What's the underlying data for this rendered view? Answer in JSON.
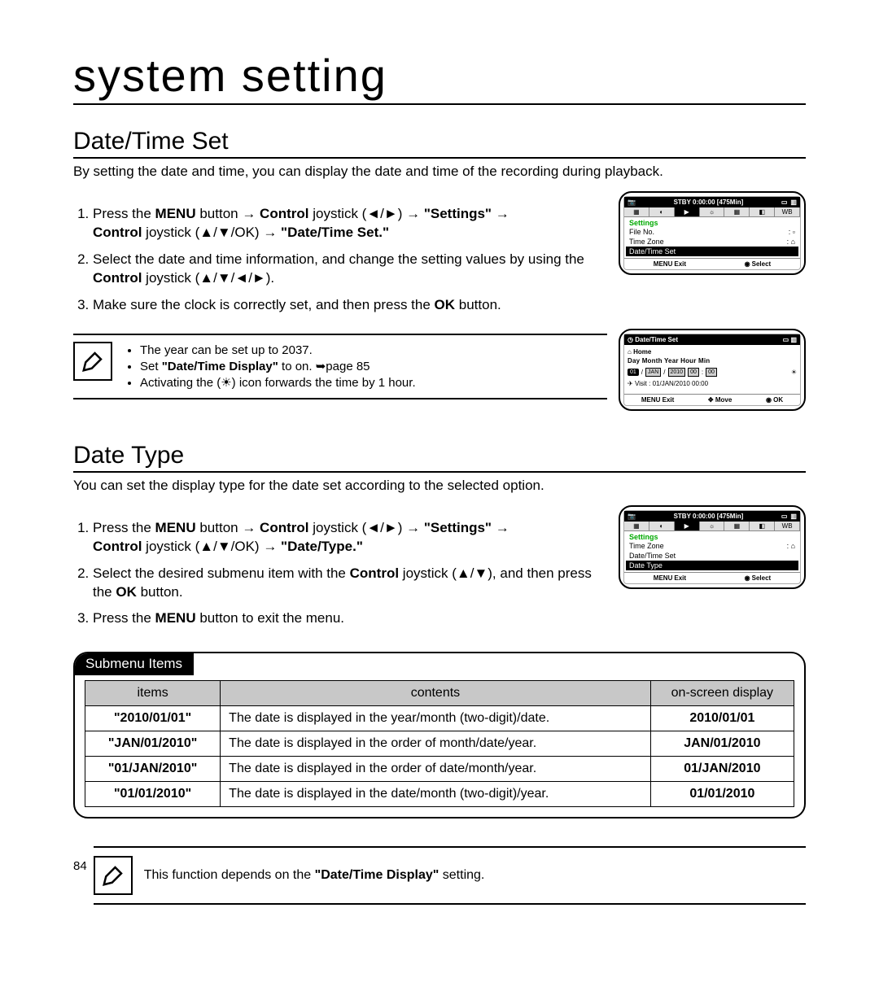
{
  "page_number": "84",
  "chapter_title": "system setting",
  "datetime": {
    "title": "Date/Time Set",
    "intro": "By setting the date and time, you can display the date and time of the recording during playback.",
    "step1_a": "Press the ",
    "step1_menu": "MENU",
    "step1_b": " button → ",
    "step1_control": "Control",
    "step1_c": " joystick (◄/►) → ",
    "step1_settings": "\"Settings\"",
    "step1_d": " → ",
    "step1_line2a": "Control",
    "step1_line2b": " joystick (▲/▼/OK) → ",
    "step1_line2c": "\"Date/Time Set.\"",
    "step2_a": "Select the date and time information, and change the setting values by using the ",
    "step2_b": "Control",
    "step2_c": " joystick (▲/▼/◄/►).",
    "step3_a": "Make sure the clock is correctly set, and then press the ",
    "step3_b": "OK",
    "step3_c": " button.",
    "note1": "The year can be set up to 2037.",
    "note2_a": "Set ",
    "note2_b": "\"Date/Time Display\"",
    "note2_c": " to on. ➥page 85",
    "note3_a": "Activating the (",
    "note3_icon": "dst-icon",
    "note3_b": ") icon forwards the time by 1 hour."
  },
  "lcd_settings": {
    "status": "STBY 0:00:00 [475Min]",
    "title": "Settings",
    "rows": [
      "File No.",
      "Time Zone",
      "Date/Time Set"
    ],
    "selected_index": 2,
    "exit": "Exit",
    "select": "Select",
    "menu": "MENU"
  },
  "lcd_dt": {
    "header": "Date/Time Set",
    "home": "Home",
    "labels": "Day  Month  Year  Hour  Min",
    "edit": [
      "01",
      "/",
      "JAN",
      "/",
      "2010",
      "00",
      ":",
      "00"
    ],
    "visit": "Visit  :  01/JAN/2010 00:00",
    "exit": "Exit",
    "move": "Move",
    "ok": "OK",
    "menu": "MENU"
  },
  "datetype": {
    "title": "Date Type",
    "intro": "You can set the display type for the date set according to the selected option.",
    "step1_a": "Press the ",
    "step1_menu": "MENU",
    "step1_b": " button → ",
    "step1_control": "Control",
    "step1_c": " joystick (◄/►) → ",
    "step1_settings": "\"Settings\"",
    "step1_d": " → ",
    "step1_line2a": "Control",
    "step1_line2b": " joystick (▲/▼/OK) → ",
    "step1_line2c": "\"Date/Type.\"",
    "step2_a": "Select the desired submenu item with the ",
    "step2_b": "Control",
    "step2_c": " joystick (▲/▼), and then press the ",
    "step2_d": "OK",
    "step2_e": " button.",
    "step3_a": "Press the ",
    "step3_b": "MENU",
    "step3_c": " button to exit the menu."
  },
  "lcd_datetype": {
    "status": "STBY 0:00:00 [475Min]",
    "title": "Settings",
    "rows": [
      "Time Zone",
      "Date/Time Set",
      "Date Type"
    ],
    "selected_index": 2,
    "exit": "Exit",
    "select": "Select",
    "menu": "MENU"
  },
  "submenu": {
    "tab": "Submenu Items",
    "headers": {
      "items": "items",
      "contents": "contents",
      "display": "on-screen display"
    },
    "rows": [
      {
        "item": "\"2010/01/01\"",
        "content": "The date is displayed in the year/month (two-digit)/date.",
        "display": "2010/01/01"
      },
      {
        "item": "\"JAN/01/2010\"",
        "content": "The date is displayed in the order of month/date/year.",
        "display": "JAN/01/2010"
      },
      {
        "item": "\"01/JAN/2010\"",
        "content": "The date is displayed in the order of date/month/year.",
        "display": "01/JAN/2010"
      },
      {
        "item": "\"01/01/2010\"",
        "content": "The date is displayed in the date/month (two-digit)/year.",
        "display": "01/01/2010"
      }
    ]
  },
  "footnote_a": "This function depends on the ",
  "footnote_b": "\"Date/Time Display\"",
  "footnote_c": " setting."
}
